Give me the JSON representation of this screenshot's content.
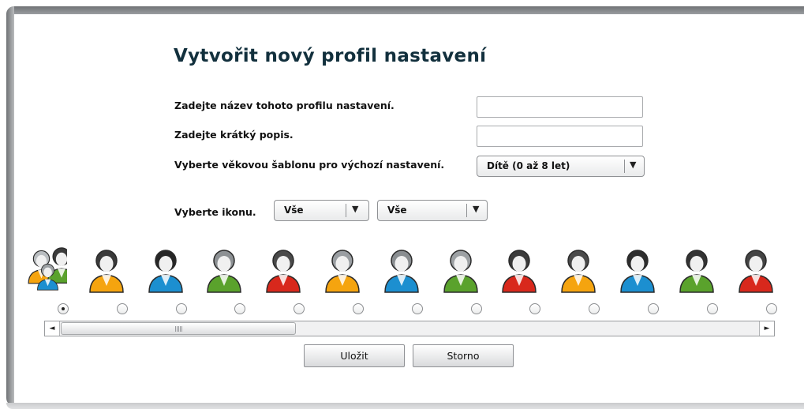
{
  "page": {
    "title": "Vytvořit nový profil nastavení"
  },
  "form": {
    "name_label": "Zadejte název tohoto profilu nastavení.",
    "name_value": "",
    "desc_label": "Zadejte krátký popis.",
    "desc_value": "",
    "template_label": "Vyberte věkovou šablonu pro výchozí nastavení.",
    "template_value": "Dítě (0 až 8 let)"
  },
  "icons": {
    "label": "Vyberte ikonu.",
    "filter1_value": "Vše",
    "filter2_value": "Vše",
    "selected_index": 0,
    "items": [
      {
        "name": "family-group-icon",
        "hair": "#b9bdc0",
        "shirt": "#f5a40f"
      },
      {
        "name": "woman-curly-hair-icon",
        "hair": "#3a3a3a",
        "shirt": "#f5a40f"
      },
      {
        "name": "woman-dark-hair-icon",
        "hair": "#262626",
        "shirt": "#1c8fd0"
      },
      {
        "name": "woman-light-hair-icon",
        "hair": "#8d9194",
        "shirt": "#5aa22c"
      },
      {
        "name": "woman-bob-hair-icon",
        "hair": "#4a4a4a",
        "shirt": "#d8281c"
      },
      {
        "name": "woman-long-hair-icon",
        "hair": "#9a9ea2",
        "shirt": "#f5a40f"
      },
      {
        "name": "woman-gray-hair-icon",
        "hair": "#8a8e91",
        "shirt": "#1c8fd0"
      },
      {
        "name": "man-light-hair-icon",
        "hair": "#9da1a4",
        "shirt": "#5aa22c"
      },
      {
        "name": "man-dark-hair-icon",
        "hair": "#3b3b3b",
        "shirt": "#d8281c"
      },
      {
        "name": "man-beard-icon",
        "hair": "#4a4a4a",
        "shirt": "#f5a40f"
      },
      {
        "name": "man-curly-hair-icon",
        "hair": "#2d2d2d",
        "shirt": "#1c8fd0"
      },
      {
        "name": "man-short-hair-icon",
        "hair": "#333333",
        "shirt": "#5aa22c"
      },
      {
        "name": "man-partial-icon",
        "hair": "#444444",
        "shirt": "#d8281c"
      }
    ]
  },
  "scrollbar": {
    "left_arrow": "◄",
    "right_arrow": "►"
  },
  "buttons": {
    "save": "Uložit",
    "cancel": "Storno"
  },
  "colors": {
    "title": "#12303d",
    "frame": "#7a7d80"
  }
}
